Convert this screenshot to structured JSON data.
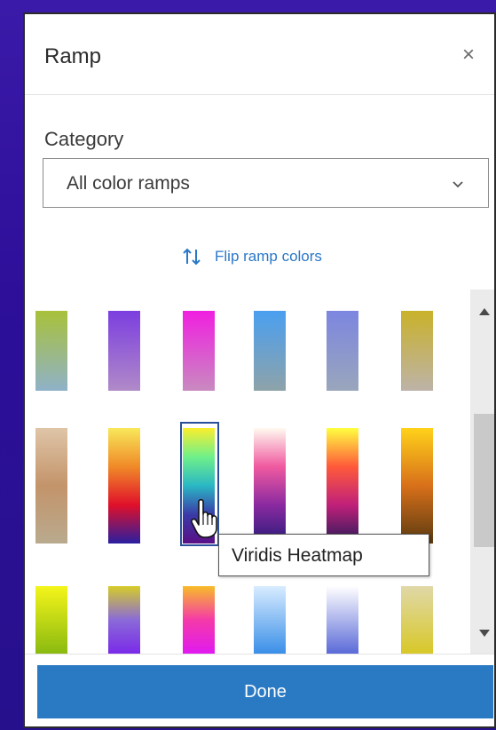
{
  "panel": {
    "title": "Ramp",
    "close_label": "×"
  },
  "category": {
    "label": "Category",
    "selected": "All color ramps"
  },
  "flip": {
    "label": "Flip ramp colors"
  },
  "ramps": [
    {
      "name": "",
      "colors": [
        "#a9c13a",
        "#8fb2c8"
      ]
    },
    {
      "name": "",
      "colors": [
        "#7c3ee0",
        "#b08ac8"
      ]
    },
    {
      "name": "",
      "colors": [
        "#f01fe0",
        "#c98ac0"
      ]
    },
    {
      "name": "",
      "colors": [
        "#4a9ff0",
        "#8ea3a9"
      ]
    },
    {
      "name": "",
      "colors": [
        "#7c86e0",
        "#9aa6bc"
      ]
    },
    {
      "name": "",
      "colors": [
        "#c9b22a",
        "#bdb3a8"
      ]
    },
    {
      "name": "",
      "colors": [
        "#dfc5a8",
        "#c3946a",
        "#b9aa8e"
      ]
    },
    {
      "name": "",
      "colors": [
        "#f8e85a",
        "#f08a28",
        "#e0102a",
        "#2a1ea0"
      ]
    },
    {
      "name": "Viridis Heatmap",
      "colors": [
        "#fbee2e",
        "#6ff08a",
        "#2ab7c4",
        "#3a3aa8",
        "#5a0f86"
      ]
    },
    {
      "name": "",
      "colors": [
        "#fffaf0",
        "#f05aa0",
        "#8a2aa0",
        "#2a1a7a"
      ]
    },
    {
      "name": "",
      "colors": [
        "#ffff40",
        "#ff5a3a",
        "#c0207a",
        "#2a1a5a"
      ]
    },
    {
      "name": "",
      "colors": [
        "#ffd21a",
        "#d8701a",
        "#5a3a10"
      ]
    },
    {
      "name": "",
      "colors": [
        "#f5f51a",
        "#8aba10"
      ]
    },
    {
      "name": "",
      "colors": [
        "#d6cc28",
        "#8a6ad8",
        "#7a2ae8"
      ]
    },
    {
      "name": "",
      "colors": [
        "#f8bc28",
        "#f53aa8",
        "#e01af0"
      ]
    },
    {
      "name": "",
      "colors": [
        "#d8ecff",
        "#3a8fe8"
      ]
    },
    {
      "name": "",
      "colors": [
        "#ffffff",
        "#5a6ad8"
      ]
    },
    {
      "name": "",
      "colors": [
        "#e0d8a8",
        "#d8c828"
      ]
    }
  ],
  "tooltip": {
    "text": "Viridis Heatmap"
  },
  "footer": {
    "done_label": "Done"
  },
  "colors": {
    "accent": "#2a7ac3",
    "link": "#2a78c8",
    "background": "#2d0f9a"
  }
}
